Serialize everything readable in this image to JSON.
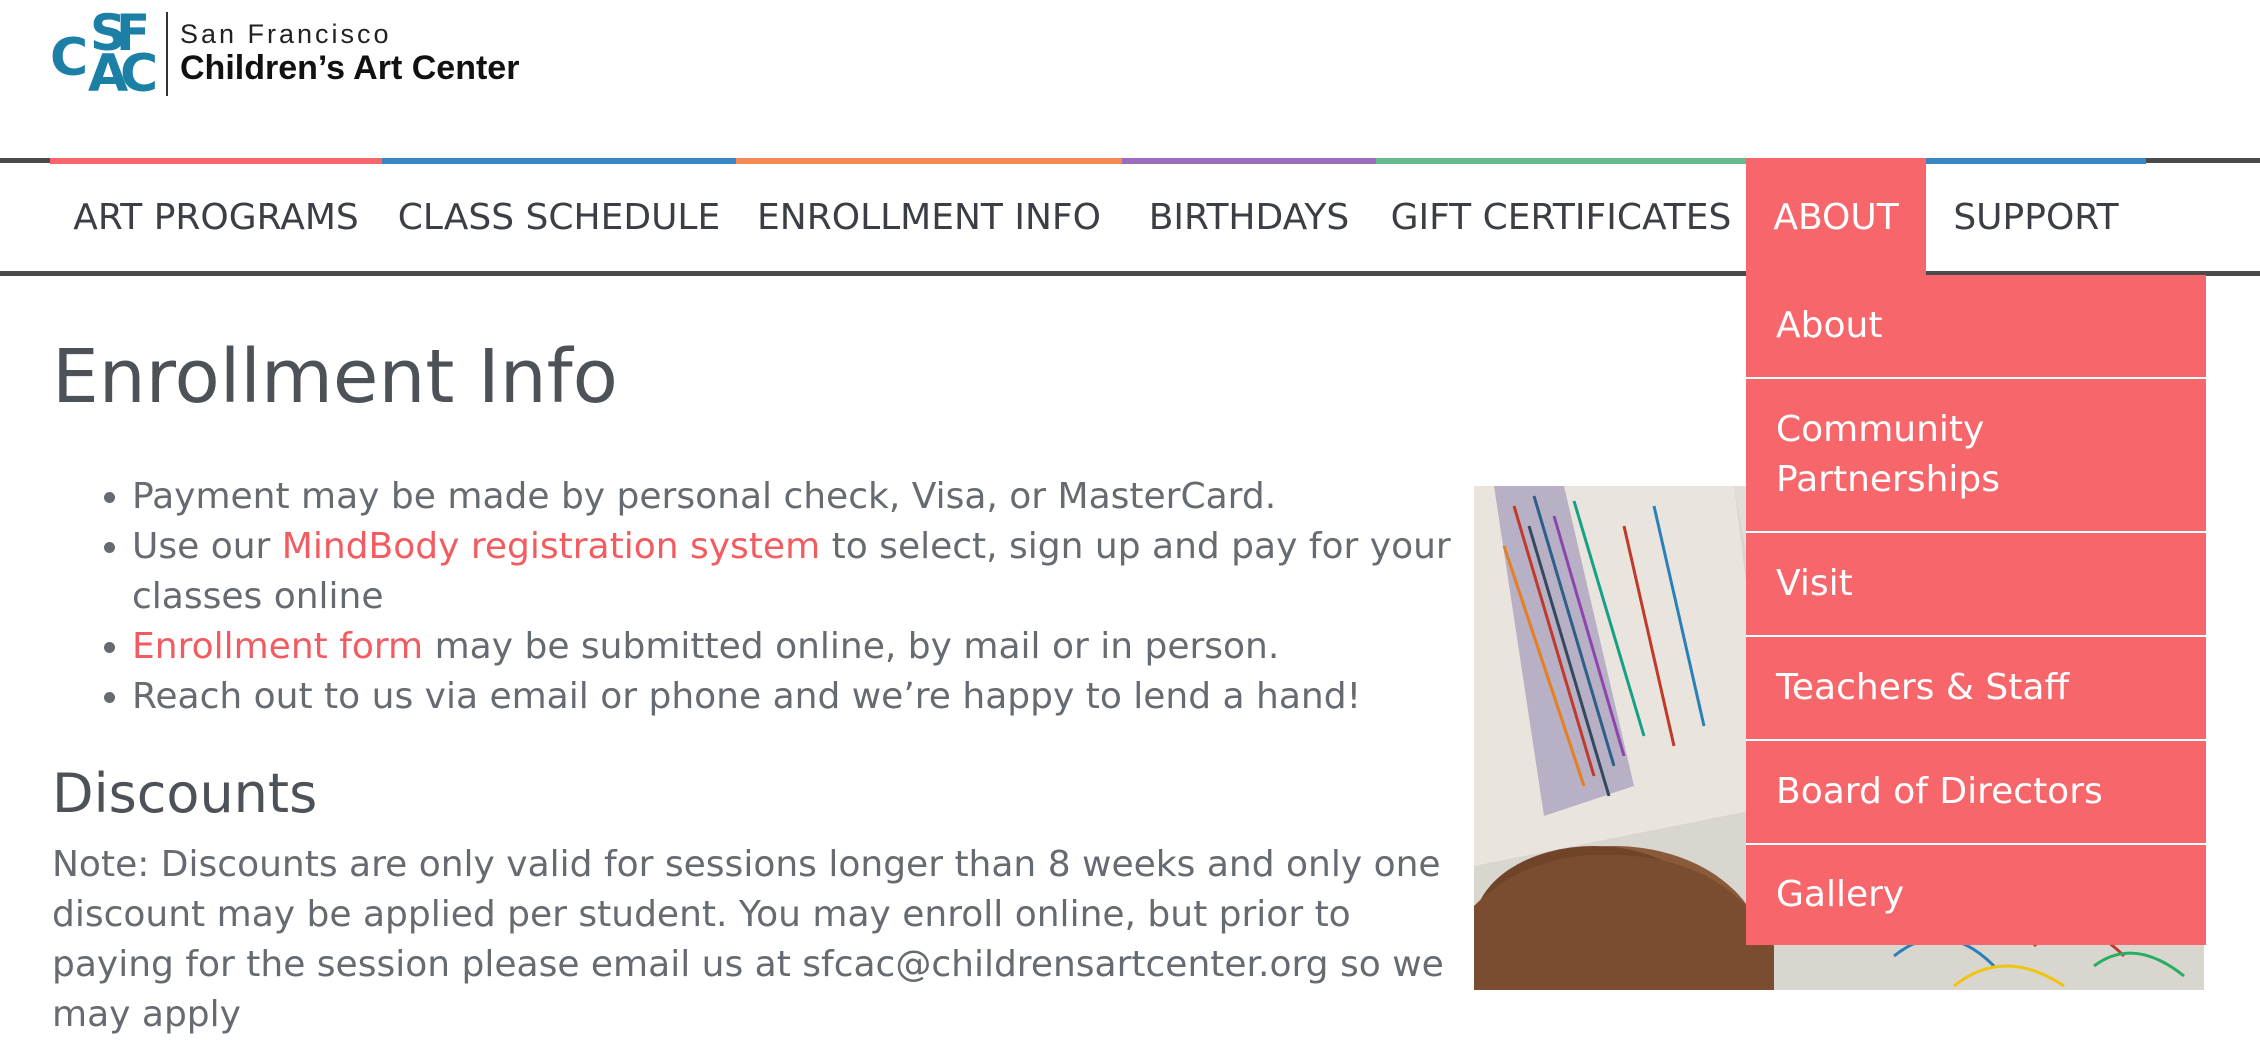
{
  "brand": {
    "logo_letters": [
      "C",
      "S",
      "F",
      "A",
      "C"
    ],
    "subtitle": "San Francisco",
    "name": "Children’s Art Center",
    "color": "#1b7fa6"
  },
  "nav": {
    "items": [
      {
        "label": "ART PROGRAMS",
        "accent": "#f7666b"
      },
      {
        "label": "CLASS SCHEDULE",
        "accent": "#3a86c4"
      },
      {
        "label": "ENROLLMENT INFO",
        "accent": "#f58a55"
      },
      {
        "label": "BIRTHDAYS",
        "accent": "#9b6bbf"
      },
      {
        "label": "GIFT CERTIFICATES",
        "accent": "#66bb8e"
      },
      {
        "label": "ABOUT",
        "accent": "#f7666b"
      },
      {
        "label": "SUPPORT",
        "accent": "#3a86c4"
      }
    ],
    "active": "ABOUT"
  },
  "dropdown": {
    "items": [
      "About",
      "Community Partnerships",
      "Visit",
      "Teachers & Staff",
      "Board of Directors",
      "Gallery"
    ]
  },
  "main": {
    "title": "Enrollment Info",
    "bullets": {
      "b1": "Payment may be made by personal check, Visa, or MasterCard.",
      "b2_pre": "Use our ",
      "b2_link": "MindBody registration system",
      "b2_post": " to select, sign up and pay for your classes online",
      "b3_link": "Enrollment form",
      "b3_post": " may be submitted online, by mail or in person.",
      "b4": "Reach out to us via email or phone and we’re happy to lend a hand!"
    },
    "discounts_heading": "Discounts",
    "discounts_text": "Note: Discounts are only valid for sessions longer than 8 weeks and only one discount may be applied per student. You may enroll online, but prior to paying for the session please email us at sfcac@childrensartcenter.org so we may apply"
  },
  "colors": {
    "accent": "#f7666b",
    "link": "#f25c61",
    "text": "#666b72",
    "heading": "#4d5258"
  }
}
